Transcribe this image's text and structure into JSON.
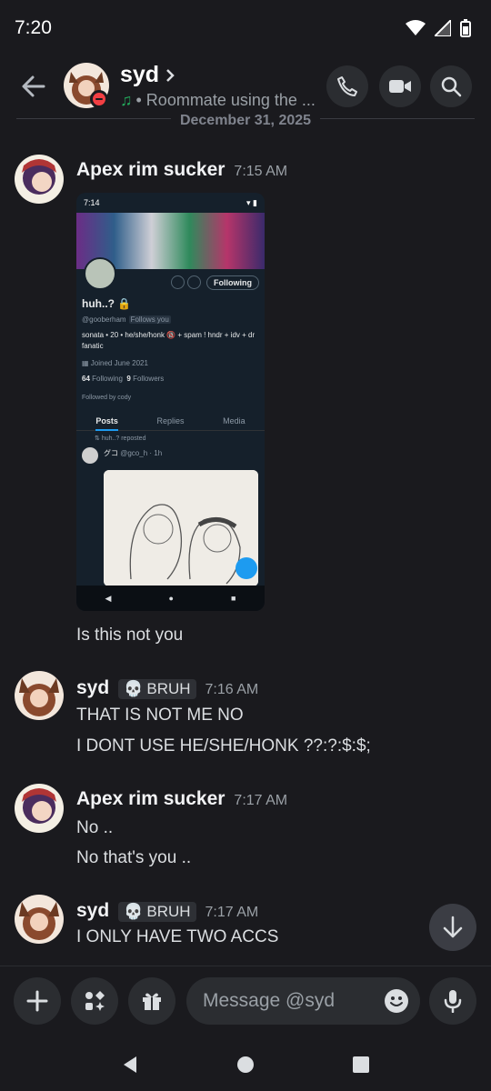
{
  "status_bar": {
    "time": "7:20"
  },
  "header": {
    "name": "syd",
    "status_text": "• Roommate using the ..."
  },
  "date_divider": "December 31, 2025",
  "messages": [
    {
      "author": "Apex rim sucker",
      "time": "7:15 AM",
      "lines": [
        "Is this not you"
      ]
    },
    {
      "author": "syd",
      "tag": "BRUH",
      "time": "7:16 AM",
      "lines": [
        "THAT IS NOT ME NO",
        "I DONT USE HE/SHE/HONK ??:?:$:$;"
      ]
    },
    {
      "author": "Apex rim sucker",
      "time": "7:17 AM",
      "lines": [
        "No ..",
        "No that's you .."
      ]
    },
    {
      "author": "syd",
      "tag": "BRUH",
      "time": "7:17 AM",
      "lines": [
        "I ONLY HAVE TWO ACCS"
      ]
    }
  ],
  "attachment": {
    "time": "7:14",
    "follow_label": "Following",
    "name": "huh..?",
    "handle": "@gooberham",
    "follows_you": "Follows you",
    "bio": "sonata • 20 • he/she/honk 🔞 + spam ! hndr + idv + dr fanatic",
    "joined": "Joined June 2021",
    "following_count": "64",
    "following_label": "Following",
    "followers_count": "9",
    "followers_label": "Followers",
    "followed_by": "Followed by cody",
    "tabs": [
      "Posts",
      "Replies",
      "Media"
    ],
    "repost_label": "huh..? reposted",
    "post_user": "グコ",
    "post_handle": "@gco_h · 1h"
  },
  "composer": {
    "placeholder": "Message @syd"
  },
  "colors": {
    "background": "#1a1a1e",
    "accent_green": "#23a55a",
    "dnd_red": "#f23f43"
  }
}
